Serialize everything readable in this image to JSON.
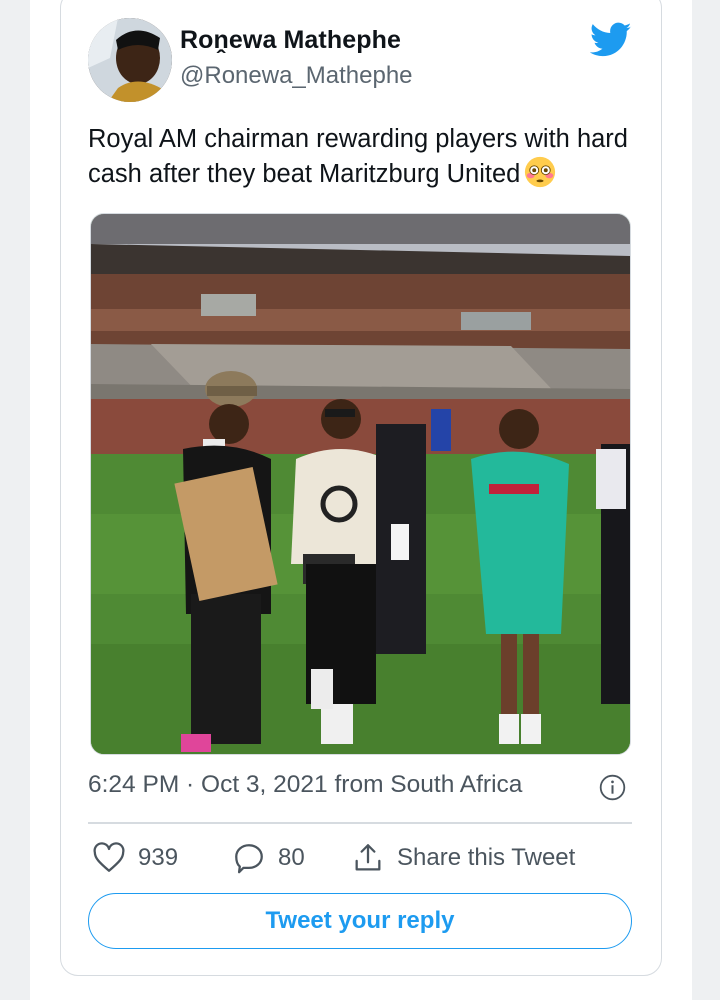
{
  "user": {
    "display_name": "Roṋewa Mathephe",
    "handle": "@Ronewa_Mathephe",
    "avatar_icon": "profile-photo"
  },
  "brand": {
    "logo_icon": "twitter-bird-icon",
    "accent": "#1d9bf0"
  },
  "tweet": {
    "text": "Royal AM chairman rewarding players with hard cash after they beat Maritzburg United",
    "emoji_icon": "flushed-face-emoji",
    "media_icon": "stadium-photo"
  },
  "meta": {
    "timestamp": "6:24 PM · Oct 3, 2021 from South Africa",
    "info_icon": "info-icon"
  },
  "actions": {
    "likes": "939",
    "replies": "80",
    "share_label": "Share this Tweet"
  },
  "reply_button": {
    "label": "Tweet your reply"
  },
  "colors": {
    "text_primary": "#0f1419",
    "text_secondary": "#5b6670",
    "border": "#d6dbe0",
    "background": "#eef0f2"
  }
}
